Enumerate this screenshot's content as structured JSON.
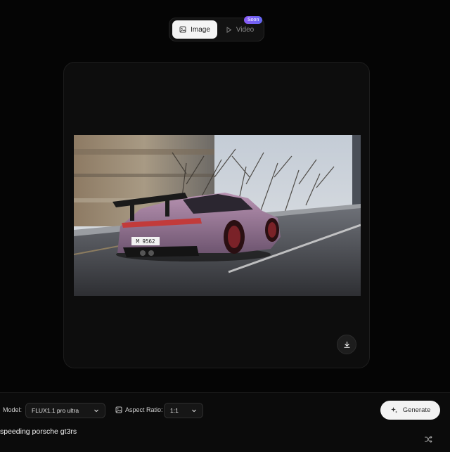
{
  "mode_toggle": {
    "image_label": "Image",
    "video_label": "Video",
    "soon_badge": "Soon"
  },
  "preview": {
    "plate_text": "M 9562"
  },
  "controls": {
    "model_label": "Model:",
    "model_value": "FLUX1.1 pro ultra",
    "aspect_label": "Aspect Ratio:",
    "aspect_value": "1:1",
    "generate_label": "Generate"
  },
  "prompt": {
    "value": "speeding porsche gt3rs"
  },
  "colors": {
    "background": "#050505",
    "card": "#0d0d0d",
    "car_body": "#a07a9c",
    "accent_badge": "#8b5cf6"
  }
}
